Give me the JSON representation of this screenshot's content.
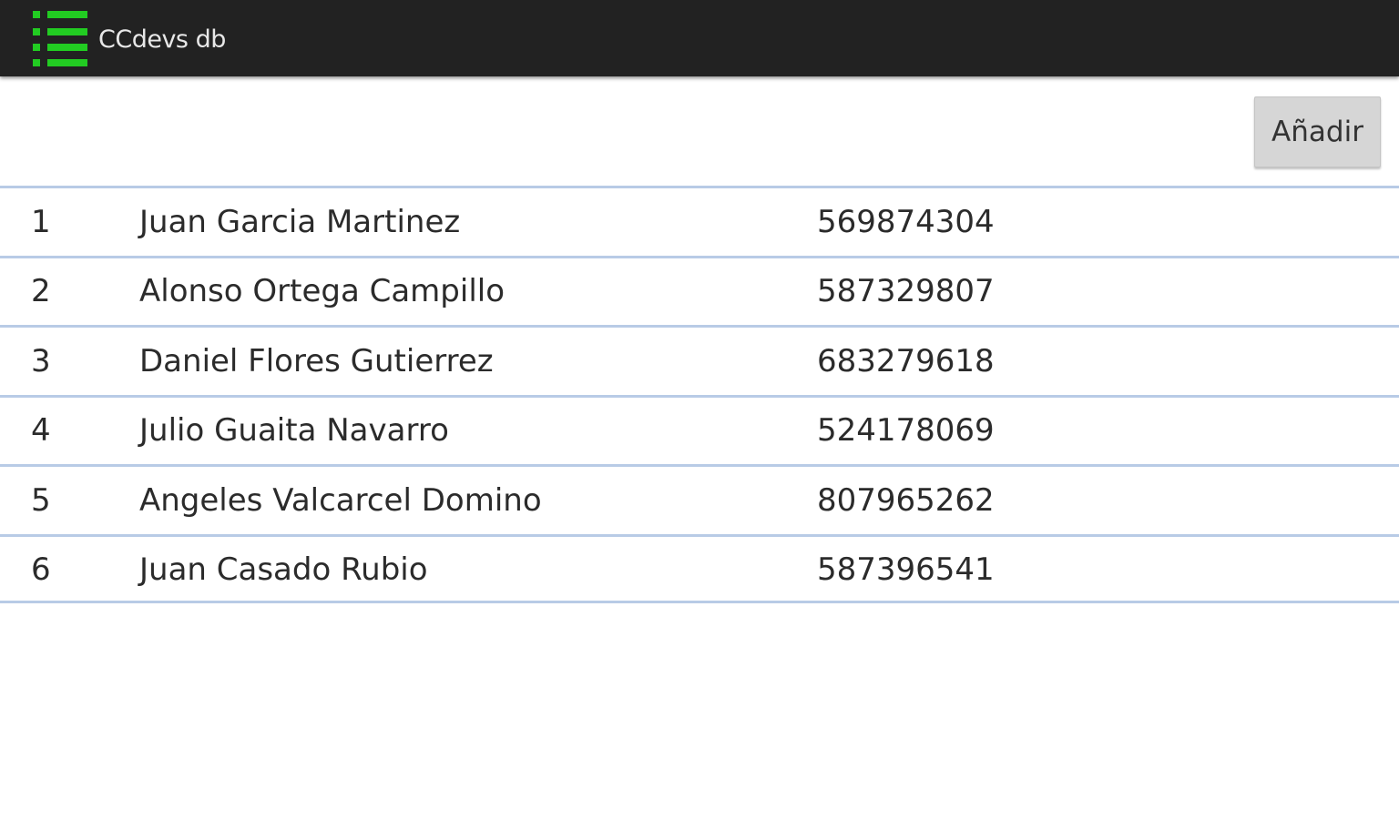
{
  "action_bar": {
    "title": "CCdevs db",
    "icon": "list-icon",
    "background_color": "#222222",
    "icon_color": "#22cc22"
  },
  "toolbar": {
    "add_label": "Añadir"
  },
  "table": {
    "separator_color": "#b8cbe6",
    "rows": [
      {
        "id": "1",
        "name": "Juan Garcia Martinez",
        "phone": "569874304"
      },
      {
        "id": "2",
        "name": "Alonso Ortega Campillo",
        "phone": "587329807"
      },
      {
        "id": "3",
        "name": "Daniel Flores Gutierrez",
        "phone": "683279618"
      },
      {
        "id": "4",
        "name": "Julio Guaita Navarro",
        "phone": "524178069"
      },
      {
        "id": "5",
        "name": "Angeles Valcarcel Domino",
        "phone": "807965262"
      },
      {
        "id": "6",
        "name": "Juan Casado Rubio",
        "phone": "587396541"
      }
    ]
  }
}
